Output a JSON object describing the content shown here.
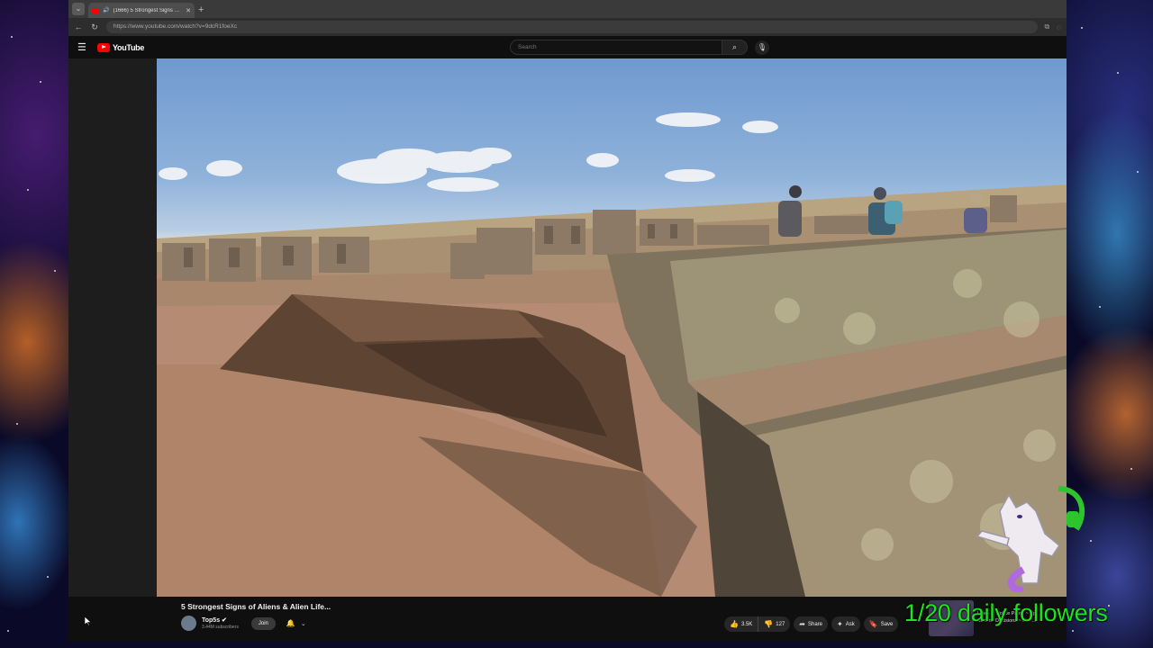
{
  "browser": {
    "tab_title": "(1666) 5 Strongest Signs of A",
    "new_tab_symbol": "+",
    "url": "https://www.youtube.com/watch?v=9dcR1foeXc"
  },
  "youtube": {
    "logo_text": "YouTube",
    "search_placeholder": "Search"
  },
  "video": {
    "title": "5 Strongest Signs of Aliens & Alien Life...",
    "channel_name": "Top5s ✔",
    "subscribers": "3.44M subscribers",
    "join_label": "Join",
    "like_count": "3.5K",
    "dislike_count": "127",
    "share_label": "Share",
    "ask_label": "Ask",
    "save_label": "Save"
  },
  "recommended": {
    "title_line1": "Live • 0: Police Patrol ~ Sp",
    "title_line2": "Second Decisions ~ Full ..."
  },
  "overlay": {
    "followers_text": "1/20 daily followers"
  },
  "icons": {
    "menu": "hamburger-icon",
    "search": "search-icon",
    "mic": "mic-icon",
    "bell": "bell-icon",
    "like": "thumbs-up-icon",
    "dislike": "thumbs-down-icon",
    "share": "share-icon",
    "ask": "sparkle-icon",
    "save": "bookmark-icon"
  },
  "colors": {
    "brand_red": "#ff0000",
    "overlay_green": "#1be51b"
  }
}
